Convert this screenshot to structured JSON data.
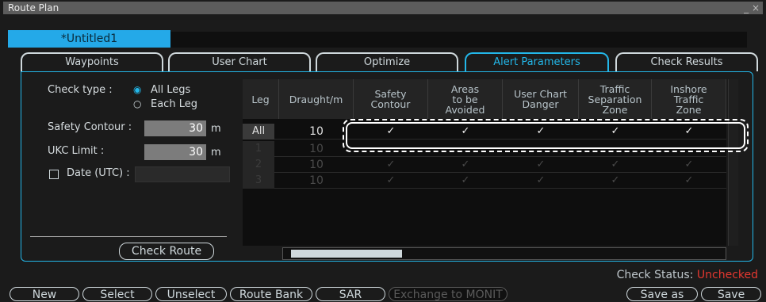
{
  "window": {
    "title": "Route Plan",
    "controls": "_ ×"
  },
  "route_tab": {
    "label": "*Untitled1"
  },
  "tabs": [
    "Waypoints",
    "User Chart",
    "Optimize",
    "Alert Parameters",
    "Check Results"
  ],
  "left": {
    "check_type_label": "Check type :",
    "options": [
      "All Legs",
      "Each Leg"
    ],
    "selected_option": "All Legs",
    "safety_contour_label": "Safety Contour :",
    "safety_contour_value": "30",
    "safety_contour_unit": "m",
    "ukc_label": "UKC Limit :",
    "ukc_value": "30",
    "ukc_unit": "m",
    "date_label": "Date (UTC) :",
    "check_route_button": "Check Route"
  },
  "table": {
    "headers": [
      "Leg",
      "Draught/m",
      "Safety\nContour",
      "Areas\nto be\nAvoided",
      "User Chart\nDanger",
      "Traffic\nSeparation\nZone",
      "Inshore\nTraffic\nZone"
    ],
    "rows": [
      {
        "leg": "All",
        "draught": "10",
        "checks": [
          "✓",
          "✓",
          "✓",
          "✓",
          "✓"
        ],
        "enabled": true
      },
      {
        "leg": "1",
        "draught": "10",
        "checks": [
          "",
          "",
          "",
          "",
          ""
        ],
        "enabled": false
      },
      {
        "leg": "2",
        "draught": "10",
        "checks": [
          "✓",
          "✓",
          "✓",
          "✓",
          "✓"
        ],
        "enabled": false
      },
      {
        "leg": "3",
        "draught": "10",
        "checks": [
          "✓",
          "✓",
          "✓",
          "✓",
          "✓"
        ],
        "enabled": false
      }
    ]
  },
  "status": {
    "label": "Check Status:",
    "value": "Unchecked",
    "value_color": "#e4372f"
  },
  "bottom_buttons": [
    "New",
    "Select",
    "Unselect",
    "Route Bank",
    "SAR",
    "Exchange to MONIT",
    "Save as",
    "Save"
  ],
  "colors": {
    "accent": "#24a9e8",
    "background": "#1b1b1b"
  }
}
